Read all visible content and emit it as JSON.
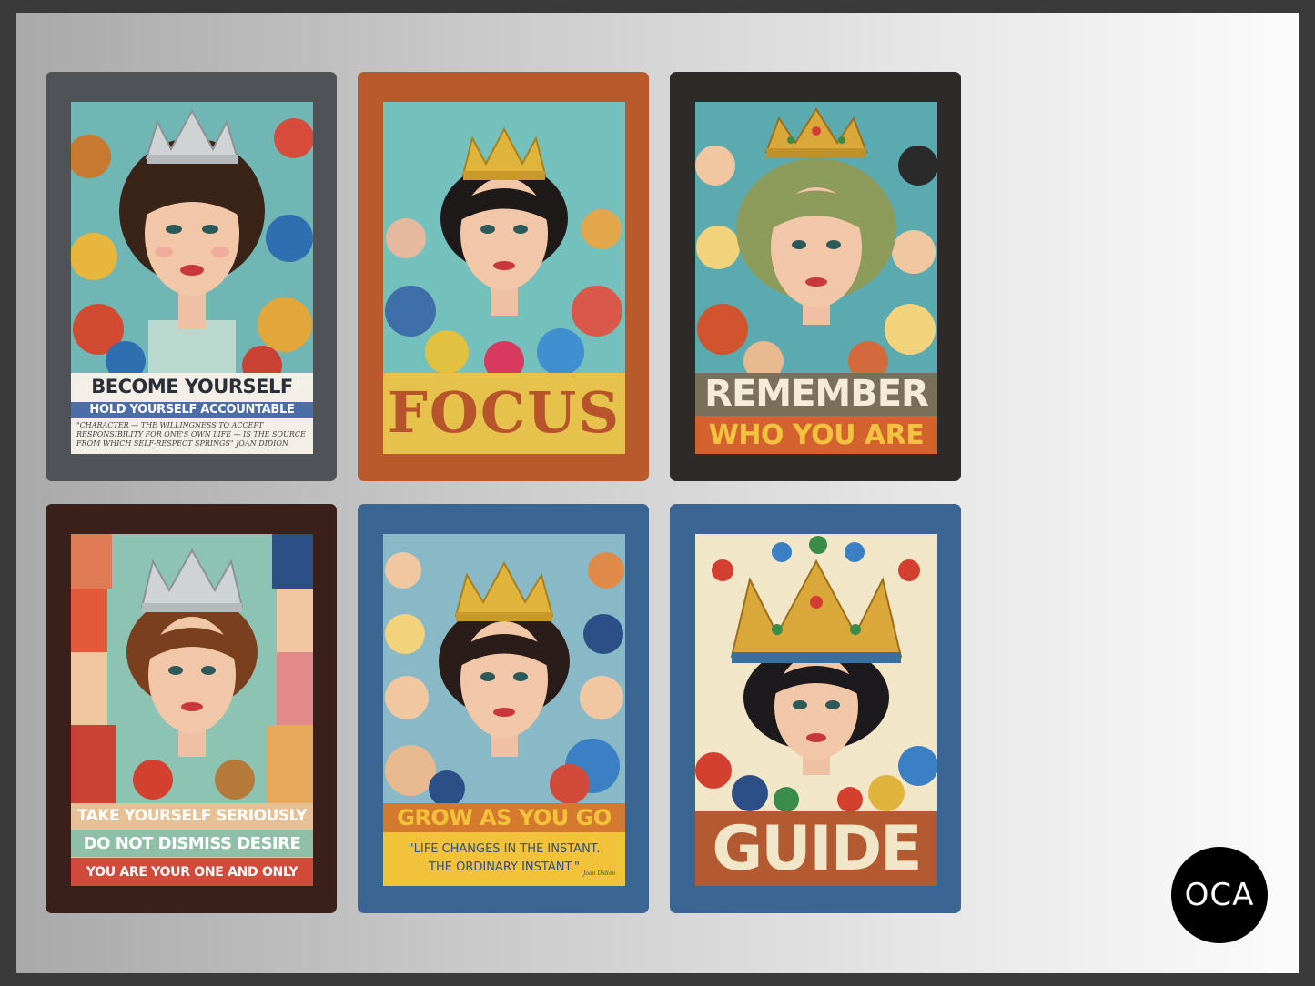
{
  "colors": {
    "frame": "#3a3a3a",
    "card_1": "#4f5358",
    "card_2": "#b85a2c",
    "card_3": "#2d2a28",
    "card_4": "#3a1f1a",
    "card_5": "#3b6593",
    "card_6": "#3b6593"
  },
  "posters": [
    {
      "line1": "BECOME YOURSELF",
      "line2": "HOLD YOURSELF ACCOUNTABLE",
      "quote": "\"CHARACTER — THE WILLINGNESS TO ACCEPT RESPONSIBILITY FOR ONE'S OWN LIFE — IS THE SOURCE FROM WHICH SELF-RESPECT SPRINGS\" JOAN DIDION"
    },
    {
      "line1": "FOCUS"
    },
    {
      "line1": "REMEMBER",
      "line2": "WHO YOU ARE"
    },
    {
      "line1": "TAKE YOURSELF SERIOUSLY",
      "line2": "DO NOT DISMISS DESIRE",
      "line3": "YOU ARE YOUR ONE AND ONLY"
    },
    {
      "line1": "GROW AS YOU GO",
      "quote_l1": "\"LIFE CHANGES IN THE INSTANT.",
      "quote_l2": "THE ORDINARY INSTANT.\"",
      "signature": "Joan Didion"
    },
    {
      "line1": "GUIDE"
    }
  ],
  "logo": {
    "text": "OCA"
  },
  "icons": [
    "crown-icon",
    "portrait-illustration",
    "oca-logo"
  ]
}
